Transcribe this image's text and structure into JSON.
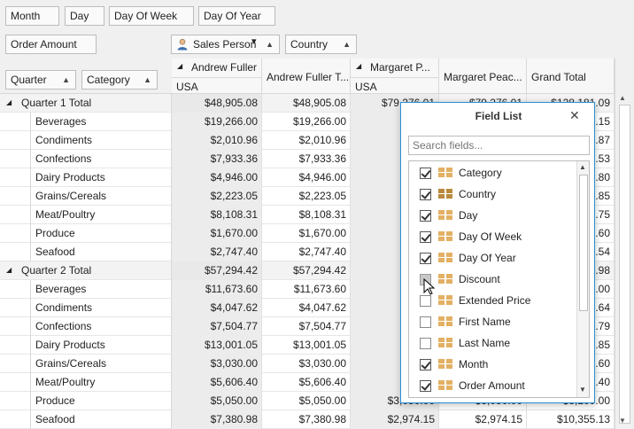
{
  "filter_fields": [
    "Month",
    "Day",
    "Day Of Week",
    "Day Of Year"
  ],
  "data_fields": [
    "Order Amount"
  ],
  "column_fields": [
    "Sales Person",
    "Country"
  ],
  "row_fields": [
    "Quarter",
    "Category"
  ],
  "column_headers": {
    "andrew": "Andrew Fuller",
    "andrew_total": "Andrew Fuller T...",
    "margaret": "Margaret P...",
    "margaret_total": "Margaret Peac...",
    "grand_total": "Grand Total",
    "country_usa": "USA"
  },
  "rows": [
    {
      "label": "Quarter 1 Total",
      "total": true,
      "c1": "$48,905.08",
      "c2": "$48,905.08",
      "c3": "$79,276.01",
      "c4": "$79,276.01",
      "c5": "$128,181.09"
    },
    {
      "label": "Beverages",
      "c1": "$19,266.00",
      "c2": "$19,266.00",
      "c3": "$23",
      "c4": "",
      "c5": ".15"
    },
    {
      "label": "Condiments",
      "c1": "$2,010.96",
      "c2": "$2,010.96",
      "c3": "$2",
      "c4": "",
      "c5": ".87"
    },
    {
      "label": "Confections",
      "c1": "$7,933.36",
      "c2": "$7,933.36",
      "c3": "$11",
      "c4": "",
      "c5": ".53"
    },
    {
      "label": "Dairy Products",
      "c1": "$4,946.00",
      "c2": "$4,946.00",
      "c3": "$13",
      "c4": "",
      "c5": ".80"
    },
    {
      "label": "Grains/Cereals",
      "c1": "$2,223.05",
      "c2": "$2,223.05",
      "c3": "$5",
      "c4": "",
      "c5": ".85"
    },
    {
      "label": "Meat/Poultry",
      "c1": "$8,108.31",
      "c2": "$8,108.31",
      "c3": "$5",
      "c4": "",
      "c5": ".75"
    },
    {
      "label": "Produce",
      "c1": "$1,670.00",
      "c2": "$1,670.00",
      "c3": "$5",
      "c4": "",
      "c5": ".60"
    },
    {
      "label": "Seafood",
      "c1": "$2,747.40",
      "c2": "$2,747.40",
      "c3": "$7",
      "c4": "",
      "c5": ".54"
    },
    {
      "label": "Quarter 2 Total",
      "total": true,
      "c1": "$57,294.42",
      "c2": "$57,294.42",
      "c3": "$40",
      "c4": "",
      "c5": ".98"
    },
    {
      "label": "Beverages",
      "c1": "$11,673.60",
      "c2": "$11,673.60",
      "c3": "$6",
      "c4": "",
      "c5": ".00"
    },
    {
      "label": "Condiments",
      "c1": "$4,047.62",
      "c2": "$4,047.62",
      "c3": "$4",
      "c4": "",
      "c5": ".64"
    },
    {
      "label": "Confections",
      "c1": "$7,504.77",
      "c2": "$7,504.77",
      "c3": "$4",
      "c4": "",
      "c5": ".79"
    },
    {
      "label": "Dairy Products",
      "c1": "$13,001.05",
      "c2": "$13,001.05",
      "c3": "$9",
      "c4": "",
      "c5": ".85"
    },
    {
      "label": "Grains/Cereals",
      "c1": "$3,030.00",
      "c2": "$3,030.00",
      "c3": "$1",
      "c4": "",
      "c5": ".60"
    },
    {
      "label": "Meat/Poultry",
      "c1": "$5,606.40",
      "c2": "$5,606.40",
      "c3": "$5",
      "c4": "",
      "c5": ".40"
    },
    {
      "label": "Produce",
      "c1": "$5,050.00",
      "c2": "$5,050.00",
      "c3": "$3,050.00",
      "c4": "$3,050.00",
      "c5": "$8,100.00"
    },
    {
      "label": "Seafood",
      "c1": "$7,380.98",
      "c2": "$7,380.98",
      "c3": "$2,974.15",
      "c4": "$2,974.15",
      "c5": "$10,355.13"
    }
  ],
  "field_list": {
    "title": "Field List",
    "close_glyph": "✕",
    "search_placeholder": "Search fields...",
    "items": [
      {
        "label": "Category",
        "checked": true,
        "icon": "dimension-icon"
      },
      {
        "label": "Country",
        "checked": true,
        "icon": "dimension-dark-icon"
      },
      {
        "label": "Day",
        "checked": true,
        "icon": "dimension-icon"
      },
      {
        "label": "Day Of Week",
        "checked": true,
        "icon": "dimension-icon"
      },
      {
        "label": "Day Of Year",
        "checked": true,
        "icon": "dimension-icon"
      },
      {
        "label": "Discount",
        "checked": false,
        "hover": true,
        "icon": "dimension-icon"
      },
      {
        "label": "Extended Price",
        "checked": false,
        "icon": "dimension-icon"
      },
      {
        "label": "First Name",
        "checked": false,
        "icon": "dimension-icon"
      },
      {
        "label": "Last Name",
        "checked": false,
        "icon": "dimension-icon"
      },
      {
        "label": "Month",
        "checked": true,
        "icon": "dimension-icon"
      },
      {
        "label": "Order Amount",
        "checked": true,
        "icon": "dimension-icon"
      }
    ]
  },
  "glyphs": {
    "collapse": "◢",
    "sort_up": "▲",
    "sort_down": "▼",
    "filter": "▾",
    "scroll_up": "▲",
    "scroll_down": "▼"
  }
}
